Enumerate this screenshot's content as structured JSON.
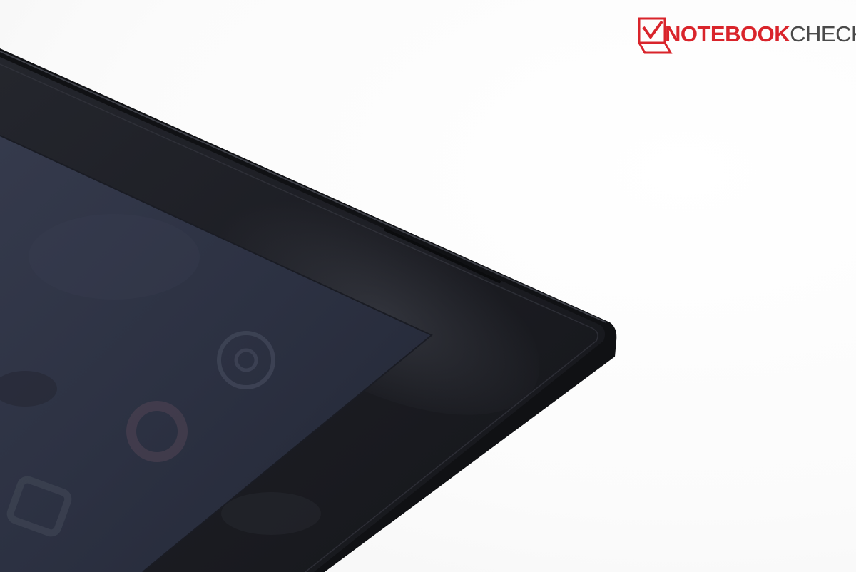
{
  "watermark": {
    "brand_bold": "NOTEBOOK",
    "brand_light": "CHECK",
    "logo_icon": "checkmark-laptop-icon",
    "brand_color": "#d9242b",
    "text_color": "#4a4a4a"
  },
  "photo": {
    "subject_icon": "tablet-corner-photo",
    "bezel_color": "#1a1b20",
    "screen_color": "#2b3040",
    "background_color": "#ffffff"
  }
}
